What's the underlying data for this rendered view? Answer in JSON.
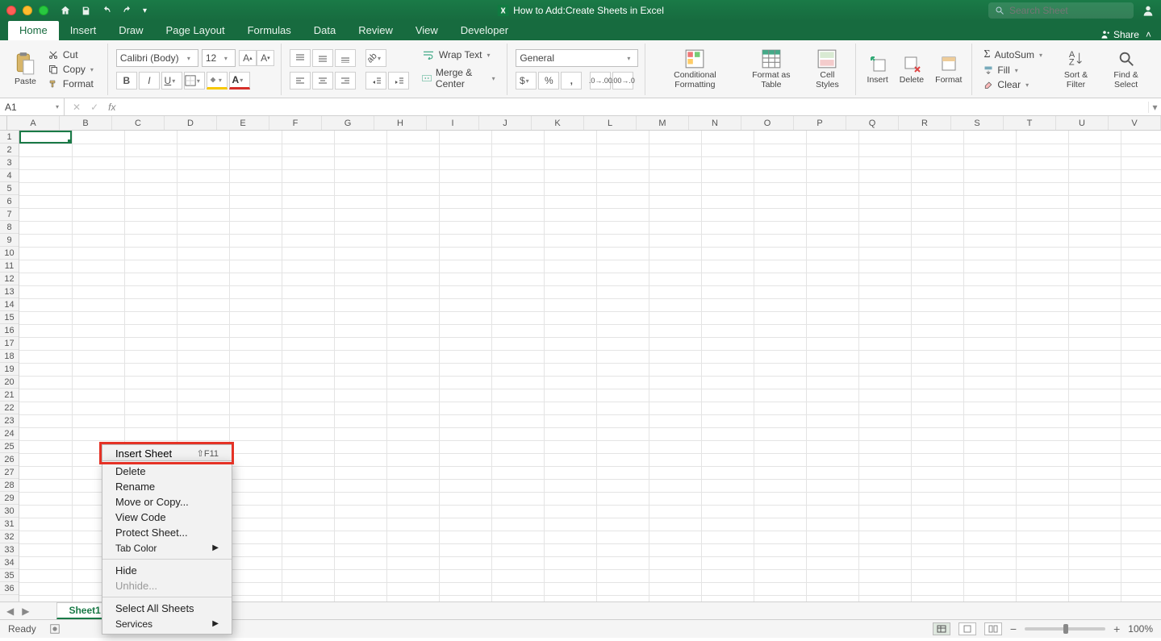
{
  "title": "How to Add:Create Sheets in Excel",
  "search_placeholder": "Search Sheet",
  "share_label": "Share",
  "tabs": [
    "Home",
    "Insert",
    "Draw",
    "Page Layout",
    "Formulas",
    "Data",
    "Review",
    "View",
    "Developer"
  ],
  "active_tab": "Home",
  "clipboard": {
    "paste": "Paste",
    "cut": "Cut",
    "copy": "Copy",
    "format": "Format"
  },
  "font": {
    "name": "Calibri (Body)",
    "size": "12"
  },
  "alignment": {
    "wrap": "Wrap Text",
    "merge": "Merge & Center"
  },
  "number": {
    "format": "General"
  },
  "styles": {
    "cond": "Conditional Formatting",
    "table": "Format as Table",
    "cell": "Cell Styles"
  },
  "cells": {
    "insert": "Insert",
    "delete": "Delete",
    "format": "Format"
  },
  "editing": {
    "autosum": "AutoSum",
    "fill": "Fill",
    "clear": "Clear",
    "sort": "Sort & Filter",
    "find": "Find & Select"
  },
  "namebox": "A1",
  "columns": [
    "A",
    "B",
    "C",
    "D",
    "E",
    "F",
    "G",
    "H",
    "I",
    "J",
    "K",
    "L",
    "M",
    "N",
    "O",
    "P",
    "Q",
    "R",
    "S",
    "T",
    "U",
    "V"
  ],
  "rows": 36,
  "context_menu": {
    "insert_sheet": "Insert Sheet",
    "insert_shortcut": "⇧F11",
    "delete": "Delete",
    "rename": "Rename",
    "move": "Move or Copy...",
    "view_code": "View Code",
    "protect": "Protect Sheet...",
    "tab_color": "Tab Color",
    "hide": "Hide",
    "unhide": "Unhide...",
    "select_all": "Select All Sheets",
    "services": "Services"
  },
  "sheet_tab": "Sheet1",
  "status": "Ready",
  "zoom": "100%"
}
